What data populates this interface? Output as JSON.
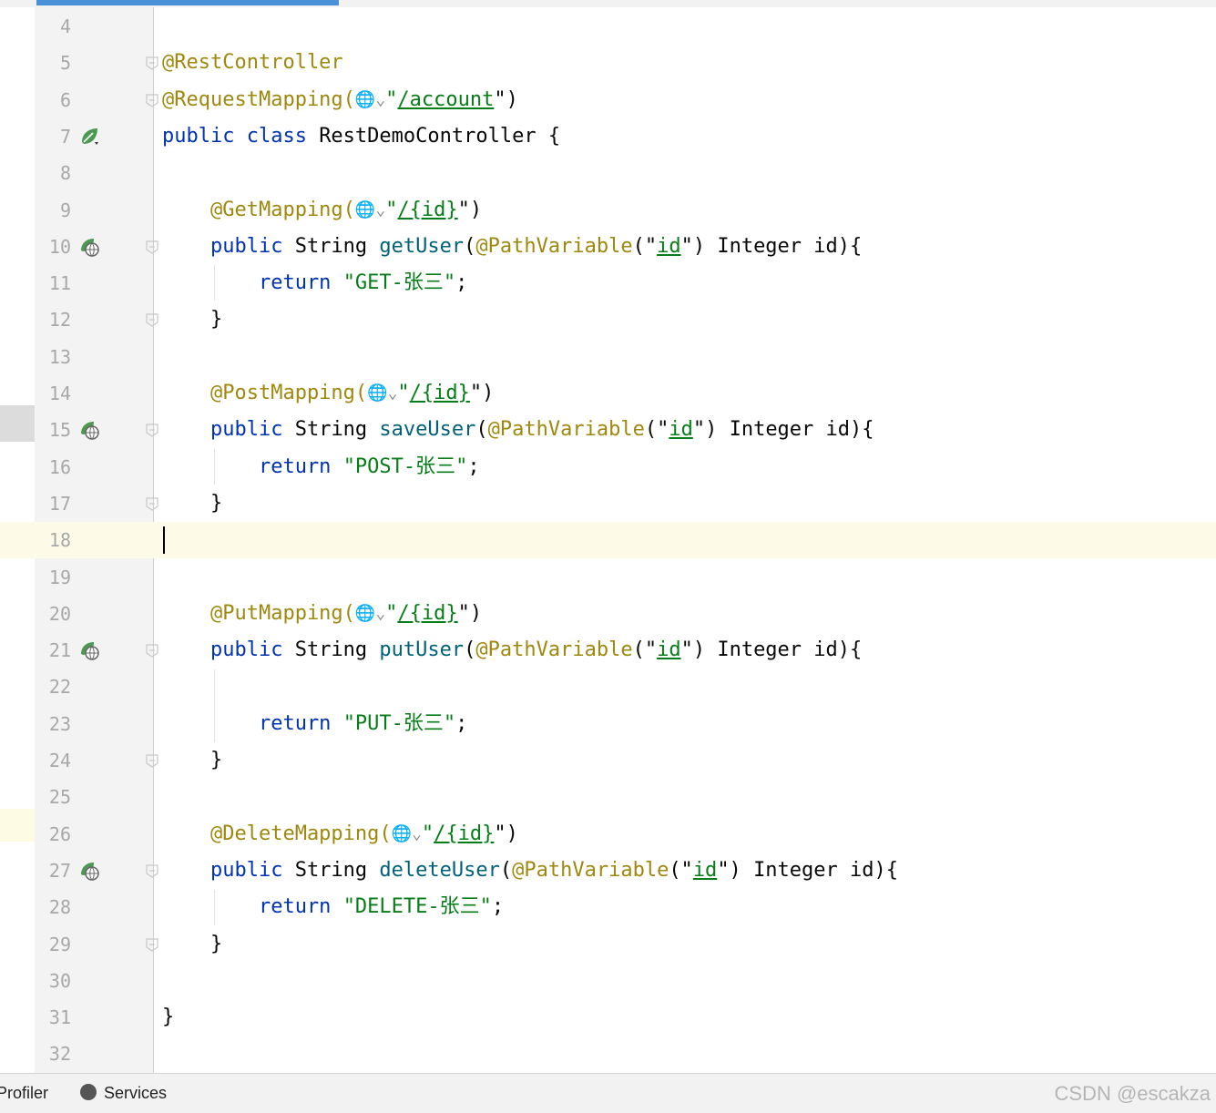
{
  "editor": {
    "current_line": 18,
    "lines": [
      {
        "n": "4",
        "icon": null,
        "fold": false,
        "tokens": []
      },
      {
        "n": "5",
        "icon": null,
        "fold": true,
        "tokens": [
          {
            "t": "@RestController",
            "c": "ann"
          }
        ]
      },
      {
        "n": "6",
        "icon": null,
        "fold": true,
        "tokens": [
          {
            "t": "@RequestMapping(",
            "c": "ann"
          },
          {
            "t": "🌐⌄",
            "c": "glob"
          },
          {
            "t": "\"",
            "c": "str"
          },
          {
            "t": "/account",
            "c": "url"
          },
          {
            "t": "\")",
            "c": "pun"
          }
        ]
      },
      {
        "n": "7",
        "icon": "spring-bean-icon",
        "fold": false,
        "tokens": [
          {
            "t": "public class ",
            "c": "kw"
          },
          {
            "t": "RestDemoController {",
            "c": "typ"
          }
        ]
      },
      {
        "n": "8",
        "icon": null,
        "fold": false,
        "tokens": []
      },
      {
        "n": "9",
        "icon": null,
        "fold": false,
        "tokens": [
          {
            "t": "    @GetMapping(",
            "c": "ann"
          },
          {
            "t": "🌐⌄",
            "c": "glob"
          },
          {
            "t": "\"",
            "c": "str"
          },
          {
            "t": "/{id}",
            "c": "url"
          },
          {
            "t": "\")",
            "c": "pun"
          }
        ]
      },
      {
        "n": "10",
        "icon": "web-endpoint-icon",
        "fold": true,
        "tokens": [
          {
            "t": "    public ",
            "c": "kw"
          },
          {
            "t": "String ",
            "c": "typ"
          },
          {
            "t": "getUser",
            "c": "fn"
          },
          {
            "t": "(",
            "c": "par"
          },
          {
            "t": "@PathVariable",
            "c": "ann"
          },
          {
            "t": "(\"",
            "c": "par"
          },
          {
            "t": "id",
            "c": "url"
          },
          {
            "t": "\") ",
            "c": "par"
          },
          {
            "t": "Integer id){",
            "c": "typ"
          }
        ]
      },
      {
        "n": "11",
        "icon": null,
        "fold": false,
        "tokens": [
          {
            "t": "        return ",
            "c": "kw"
          },
          {
            "t": "\"GET-张三\"",
            "c": "str"
          },
          {
            "t": ";",
            "c": "pun"
          }
        ]
      },
      {
        "n": "12",
        "icon": null,
        "fold": true,
        "tokens": [
          {
            "t": "    }",
            "c": "pun"
          }
        ]
      },
      {
        "n": "13",
        "icon": null,
        "fold": false,
        "tokens": []
      },
      {
        "n": "14",
        "icon": null,
        "fold": false,
        "tokens": [
          {
            "t": "    @PostMapping(",
            "c": "ann"
          },
          {
            "t": "🌐⌄",
            "c": "glob"
          },
          {
            "t": "\"",
            "c": "str"
          },
          {
            "t": "/{id}",
            "c": "url"
          },
          {
            "t": "\")",
            "c": "pun"
          }
        ]
      },
      {
        "n": "15",
        "icon": "web-endpoint-icon",
        "fold": true,
        "tokens": [
          {
            "t": "    public ",
            "c": "kw"
          },
          {
            "t": "String ",
            "c": "typ"
          },
          {
            "t": "saveUser",
            "c": "fn"
          },
          {
            "t": "(",
            "c": "par"
          },
          {
            "t": "@PathVariable",
            "c": "ann"
          },
          {
            "t": "(\"",
            "c": "par"
          },
          {
            "t": "id",
            "c": "url"
          },
          {
            "t": "\") ",
            "c": "par"
          },
          {
            "t": "Integer id){",
            "c": "typ"
          }
        ]
      },
      {
        "n": "16",
        "icon": null,
        "fold": false,
        "tokens": [
          {
            "t": "        return ",
            "c": "kw"
          },
          {
            "t": "\"POST-张三\"",
            "c": "str"
          },
          {
            "t": ";",
            "c": "pun"
          }
        ]
      },
      {
        "n": "17",
        "icon": null,
        "fold": true,
        "tokens": [
          {
            "t": "    }",
            "c": "pun"
          }
        ]
      },
      {
        "n": "18",
        "icon": null,
        "fold": false,
        "tokens": []
      },
      {
        "n": "19",
        "icon": null,
        "fold": false,
        "tokens": []
      },
      {
        "n": "20",
        "icon": null,
        "fold": false,
        "tokens": [
          {
            "t": "    @PutMapping(",
            "c": "ann"
          },
          {
            "t": "🌐⌄",
            "c": "glob"
          },
          {
            "t": "\"",
            "c": "str"
          },
          {
            "t": "/{id}",
            "c": "url"
          },
          {
            "t": "\")",
            "c": "pun"
          }
        ]
      },
      {
        "n": "21",
        "icon": "web-endpoint-icon",
        "fold": true,
        "tokens": [
          {
            "t": "    public ",
            "c": "kw"
          },
          {
            "t": "String ",
            "c": "typ"
          },
          {
            "t": "putUser",
            "c": "fn"
          },
          {
            "t": "(",
            "c": "par"
          },
          {
            "t": "@PathVariable",
            "c": "ann"
          },
          {
            "t": "(\"",
            "c": "par"
          },
          {
            "t": "id",
            "c": "url"
          },
          {
            "t": "\") ",
            "c": "par"
          },
          {
            "t": "Integer id){",
            "c": "typ"
          }
        ]
      },
      {
        "n": "22",
        "icon": null,
        "fold": false,
        "tokens": []
      },
      {
        "n": "23",
        "icon": null,
        "fold": false,
        "tokens": [
          {
            "t": "        return ",
            "c": "kw"
          },
          {
            "t": "\"PUT-张三\"",
            "c": "str"
          },
          {
            "t": ";",
            "c": "pun"
          }
        ]
      },
      {
        "n": "24",
        "icon": null,
        "fold": true,
        "tokens": [
          {
            "t": "    }",
            "c": "pun"
          }
        ]
      },
      {
        "n": "25",
        "icon": null,
        "fold": false,
        "tokens": []
      },
      {
        "n": "26",
        "icon": null,
        "fold": false,
        "tokens": [
          {
            "t": "    @DeleteMapping(",
            "c": "ann"
          },
          {
            "t": "🌐⌄",
            "c": "glob"
          },
          {
            "t": "\"",
            "c": "str"
          },
          {
            "t": "/{id}",
            "c": "url"
          },
          {
            "t": "\")",
            "c": "pun"
          }
        ]
      },
      {
        "n": "27",
        "icon": "web-endpoint-icon",
        "fold": true,
        "tokens": [
          {
            "t": "    public ",
            "c": "kw"
          },
          {
            "t": "String ",
            "c": "typ"
          },
          {
            "t": "deleteUser",
            "c": "fn"
          },
          {
            "t": "(",
            "c": "par"
          },
          {
            "t": "@PathVariable",
            "c": "ann"
          },
          {
            "t": "(\"",
            "c": "par"
          },
          {
            "t": "id",
            "c": "url"
          },
          {
            "t": "\") ",
            "c": "par"
          },
          {
            "t": "Integer id){",
            "c": "typ"
          }
        ]
      },
      {
        "n": "28",
        "icon": null,
        "fold": false,
        "tokens": [
          {
            "t": "        return ",
            "c": "kw"
          },
          {
            "t": "\"DELETE-张三\"",
            "c": "str"
          },
          {
            "t": ";",
            "c": "pun"
          }
        ]
      },
      {
        "n": "29",
        "icon": null,
        "fold": true,
        "tokens": [
          {
            "t": "    }",
            "c": "pun"
          }
        ]
      },
      {
        "n": "30",
        "icon": null,
        "fold": false,
        "tokens": []
      },
      {
        "n": "31",
        "icon": null,
        "fold": false,
        "tokens": [
          {
            "t": "}",
            "c": "pun"
          }
        ]
      },
      {
        "n": "32",
        "icon": null,
        "fold": false,
        "tokens": []
      }
    ]
  },
  "statusbar": {
    "profiler_label": "Profiler",
    "services_label": "Services",
    "watermark": "CSDN @escakza"
  },
  "colors": {
    "annotation": "#9e880d",
    "keyword": "#0033b3",
    "string": "#067d17",
    "method": "#00627a",
    "gutter_icon": "#4c9a52"
  }
}
